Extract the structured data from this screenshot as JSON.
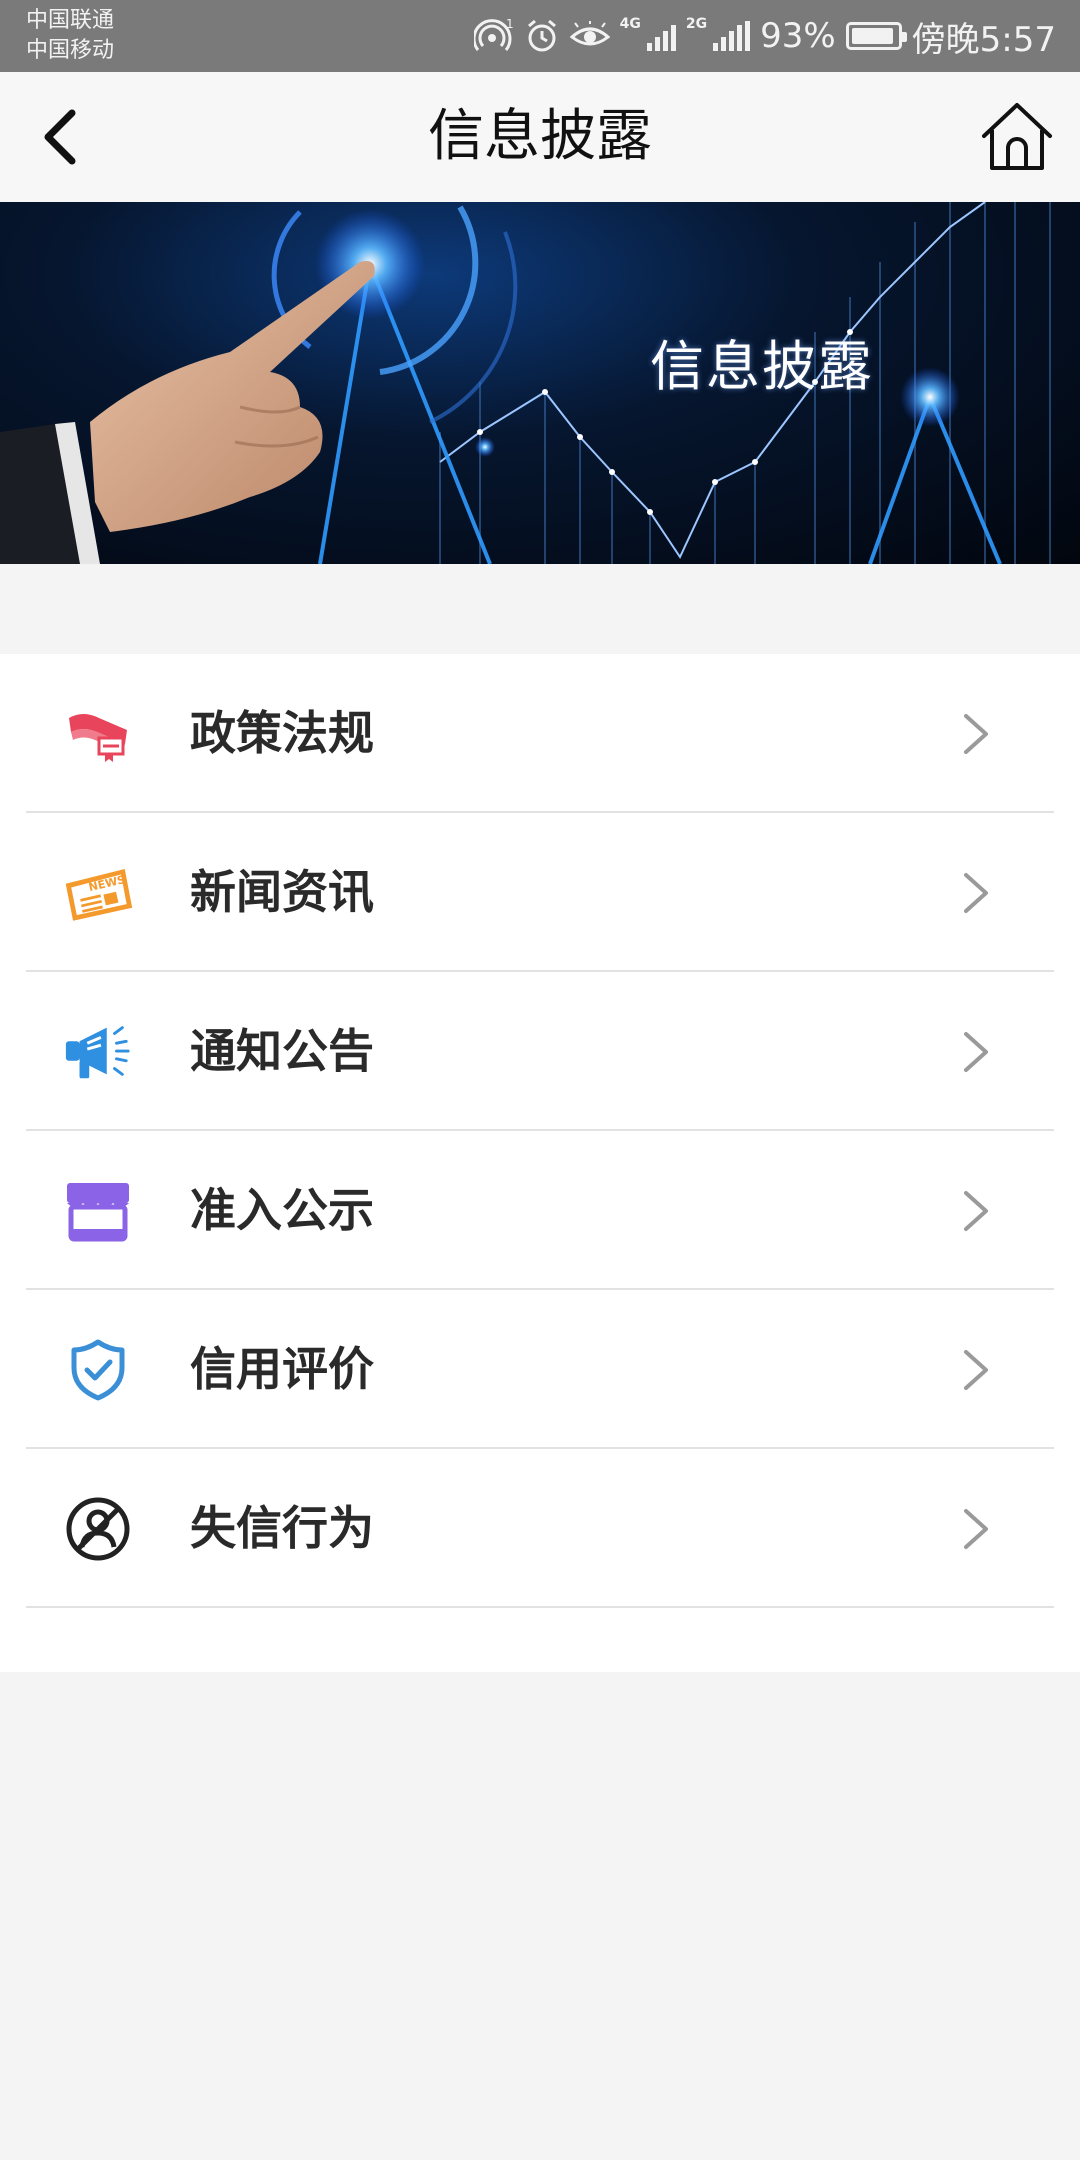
{
  "status_bar": {
    "carrier1": "中国联通",
    "carrier2": "中国移动",
    "net1": "4G",
    "net2": "2G",
    "battery_percent": "93%",
    "time": "傍晚5:57"
  },
  "nav": {
    "title": "信息披露"
  },
  "banner": {
    "text": "信息披露"
  },
  "menu": {
    "items": [
      {
        "label": "政策法规",
        "icon": "law-book-icon",
        "color": "#e8455c"
      },
      {
        "label": "新闻资讯",
        "icon": "newspaper-icon",
        "color": "#f49a2c"
      },
      {
        "label": "通知公告",
        "icon": "megaphone-icon",
        "color": "#2f8fe0"
      },
      {
        "label": "准入公示",
        "icon": "storefront-icon",
        "color": "#8a63e6"
      },
      {
        "label": "信用评价",
        "icon": "shield-check-icon",
        "color": "#3a8fd6"
      },
      {
        "label": "失信行为",
        "icon": "prohibited-person-icon",
        "color": "#222222"
      }
    ]
  },
  "colors": {
    "status_bar_bg": "#7a7a7a",
    "nav_bg": "#f7f7f7",
    "page_bg": "#f4f4f4",
    "chevron": "#9a9a9a"
  }
}
